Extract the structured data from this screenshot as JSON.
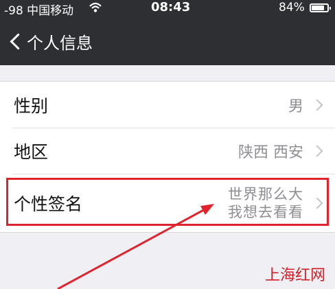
{
  "status_bar": {
    "carrier": "-98 中国移动",
    "time": "08:43",
    "battery_percent": "84%",
    "battery_level": 0.84
  },
  "nav": {
    "back_label": "个人信息"
  },
  "rows": [
    {
      "label": "性别",
      "value": "男"
    },
    {
      "label": "地区",
      "value": "陕西 西安"
    },
    {
      "label": "个性签名",
      "value_line1": "世界那么大",
      "value_line2": "我想去看看"
    }
  ],
  "watermark": "上海红网",
  "colors": {
    "nav_bg": "#2e2f33",
    "highlight": "#e0242d",
    "page_bg": "#efeff4"
  }
}
